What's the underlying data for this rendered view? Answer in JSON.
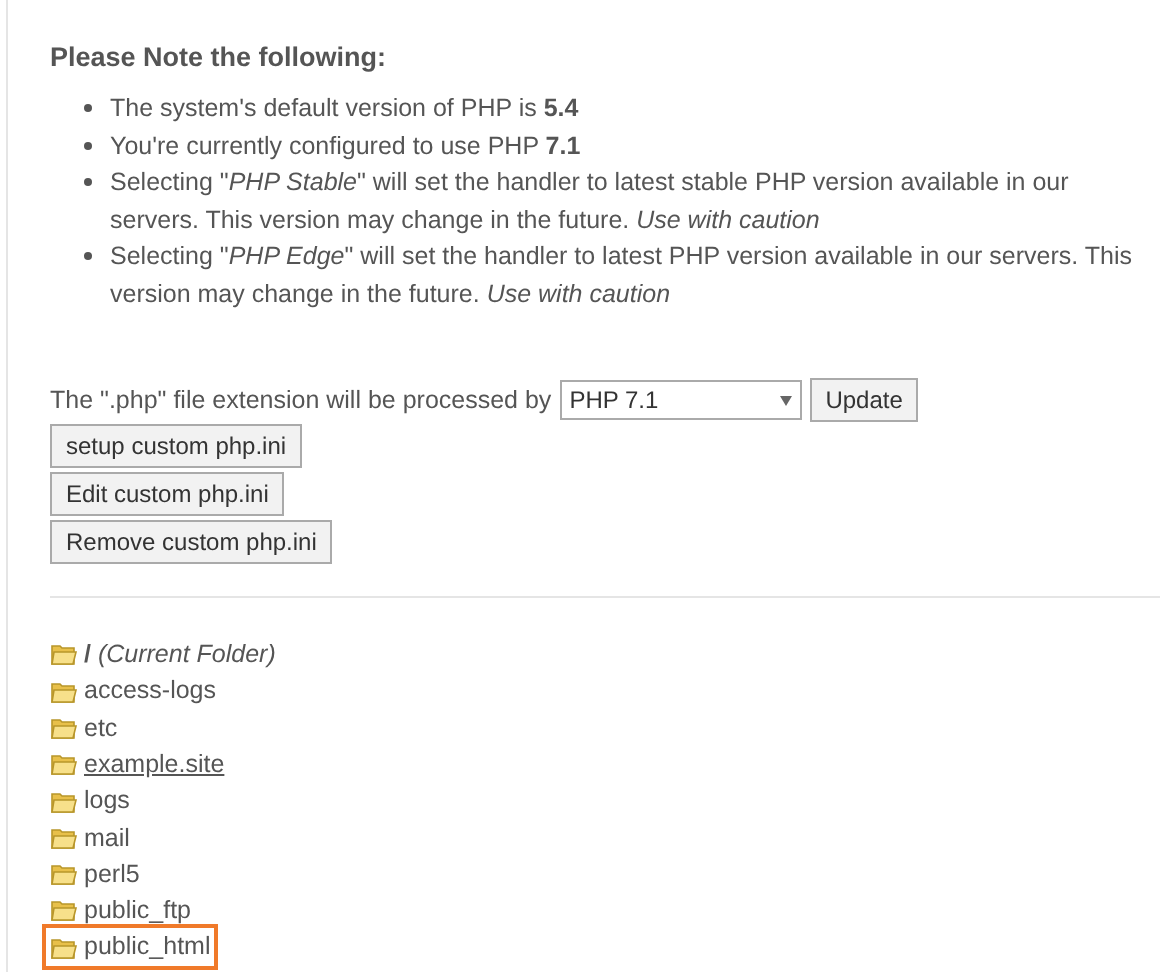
{
  "heading": "Please Note the following:",
  "notes": [
    "The system's default version of PHP is **5.4**",
    "You're currently configured to use PHP **7.1**",
    "Selecting \"*PHP Stable*\" will set the handler to latest stable PHP version available in our servers. This version may change in the future. *Use with caution*",
    "Selecting \"*PHP Edge*\" will set the handler to latest PHP version available in our servers. This version may change in the future. *Use with caution*"
  ],
  "handler": {
    "label": "The \".php\" file extension will be processed by",
    "value": "PHP 7.1",
    "button": "Update"
  },
  "ini_buttons": [
    "setup custom php.ini",
    "Edit custom php.ini",
    "Remove custom php.ini"
  ],
  "folders": [
    {
      "label": "**/** *(Current Folder)*",
      "underlined": false,
      "highlighted": false
    },
    {
      "label": "access-logs",
      "underlined": false,
      "highlighted": false
    },
    {
      "label": "etc",
      "underlined": false,
      "highlighted": false
    },
    {
      "label": "example.site",
      "underlined": true,
      "highlighted": false
    },
    {
      "label": "logs",
      "underlined": false,
      "highlighted": false
    },
    {
      "label": "mail",
      "underlined": false,
      "highlighted": false
    },
    {
      "label": "perl5",
      "underlined": false,
      "highlighted": false
    },
    {
      "label": "public_ftp",
      "underlined": false,
      "highlighted": false
    },
    {
      "label": "public_html",
      "underlined": false,
      "highlighted": true
    }
  ]
}
